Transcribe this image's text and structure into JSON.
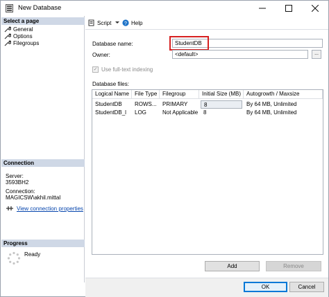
{
  "window": {
    "title": "New Database"
  },
  "leftpane": {
    "select_page_header": "Select a page",
    "pages": [
      "General",
      "Options",
      "Filegroups"
    ],
    "connection_header": "Connection",
    "server_label": "Server:",
    "server_value": "3593BH2",
    "connection_label": "Connection:",
    "connection_value": "MAGICSW\\akhil.mittal",
    "view_connection_link": "View connection properties",
    "progress_header": "Progress",
    "progress_status": "Ready"
  },
  "toolbar": {
    "script_label": "Script",
    "help_label": "Help"
  },
  "form": {
    "database_name_label": "Database name:",
    "database_name_value": "StudentDB",
    "owner_label": "Owner:",
    "owner_value": "<default>",
    "owner_button": "...",
    "fulltext_label": "Use full-text indexing",
    "fulltext_checked": true,
    "database_files_label": "Database files:"
  },
  "grid": {
    "columns": [
      "Logical Name",
      "File Type",
      "Filegroup",
      "Initial Size (MB)",
      "Autogrowth / Maxsize"
    ],
    "rows": [
      [
        "StudentDB",
        "ROWS...",
        "PRIMARY",
        "8",
        "By 64 MB, Unlimited"
      ],
      [
        "StudentDB_l",
        "LOG",
        "Not Applicable",
        "8",
        "By 64 MB, Unlimited"
      ]
    ]
  },
  "buttons": {
    "add": "Add",
    "remove": "Remove",
    "ok": "OK",
    "cancel": "Cancel"
  },
  "colors": {
    "highlight": "#d61f1f",
    "section_header": "#cfd8e6",
    "link": "#0645ad"
  },
  "icons": {
    "window": "database-icon",
    "minimize": "minimize-icon",
    "maximize": "maximize-icon",
    "close": "close-icon"
  }
}
